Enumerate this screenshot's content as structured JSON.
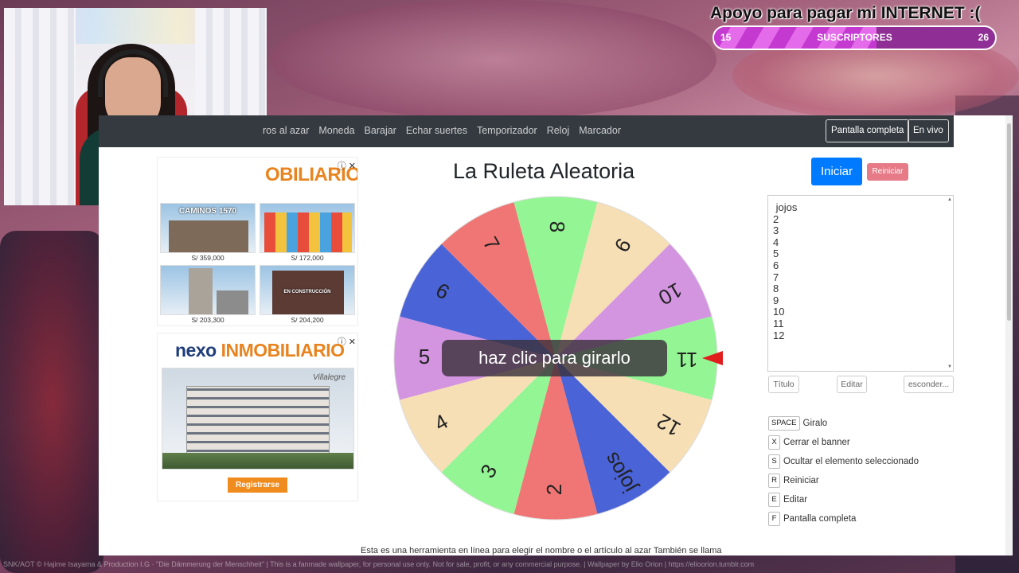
{
  "stream": {
    "goal_title": "Apoyo para pagar mi INTERNET :(",
    "goal_current": "15",
    "goal_label": "SUSCRIPTORES",
    "goal_target": "26",
    "goal_progress_fraction": 0.577,
    "credits": "SNK/AOT © Hajime Isayama & Production I.G · \"Die Dämmerung der Menschheit\" | This is a fanmade wallpaper, for personal use only. Not for sale, profit, or any commercial purpose. | Wallpaper by Elio Orion | https://elioorion.tumblr.com"
  },
  "navbar": {
    "links": [
      "ros al azar",
      "Moneda",
      "Barajar",
      "Echar suertes",
      "Temporizador",
      "Reloj",
      "Marcador"
    ],
    "fullscreen_label": "Pantalla completa",
    "live_label": "En vivo"
  },
  "ad1": {
    "title": "OBILIARIO",
    "tiles": [
      {
        "text": "CAMINOS 1570",
        "price": "S/ 359,000"
      },
      {
        "text": "",
        "price": "S/ 172,000"
      },
      {
        "text": "",
        "price": "S/ 203,300"
      },
      {
        "text": "EN CONSTRUCCIÓN",
        "price": "S/ 204,200"
      }
    ]
  },
  "ad2": {
    "logo_nexo": "nexo",
    "logo_inmo": " INMOBILIARIO",
    "subtitle": "Villalegre",
    "button": "Registrarse"
  },
  "main": {
    "title": "La Ruleta Aleatoria",
    "overlay": "haz clic para girarlo",
    "start_label": "Iniciar",
    "reset_label": "Reiniciar",
    "entries_text": " jojos\n2\n3\n4\n5\n6\n7\n8\n9\n10\n11\n12",
    "title_btn": "Título",
    "edit_btn": "Editar",
    "hide_btn": "esconder...",
    "footer": "Esta es una herramienta en línea para elegir el nombre o el artículo al azar También se llama"
  },
  "wheel": {
    "segments": [
      {
        "label": "jojos",
        "color": "#4a63d6"
      },
      {
        "label": "2",
        "color": "#f07575"
      },
      {
        "label": "3",
        "color": "#93f593"
      },
      {
        "label": "4",
        "color": "#f7dfb5"
      },
      {
        "label": "5",
        "color": "#d394e0"
      },
      {
        "label": "6",
        "color": "#4a63d6"
      },
      {
        "label": "7",
        "color": "#f07575"
      },
      {
        "label": "8",
        "color": "#93f593"
      },
      {
        "label": "9",
        "color": "#f7dfb5"
      },
      {
        "label": "10",
        "color": "#d394e0"
      },
      {
        "label": "11",
        "color": "#93f593"
      },
      {
        "label": "12",
        "color": "#f7dfb5"
      }
    ]
  },
  "shortcuts": [
    {
      "key": "SPACE",
      "label": "Giralo"
    },
    {
      "key": "X",
      "label": "Cerrar el banner"
    },
    {
      "key": "S",
      "label": "Ocultar el elemento seleccionado"
    },
    {
      "key": "R",
      "label": "Reiniciar"
    },
    {
      "key": "E",
      "label": "Editar"
    },
    {
      "key": "F",
      "label": "Pantalla completa"
    }
  ]
}
